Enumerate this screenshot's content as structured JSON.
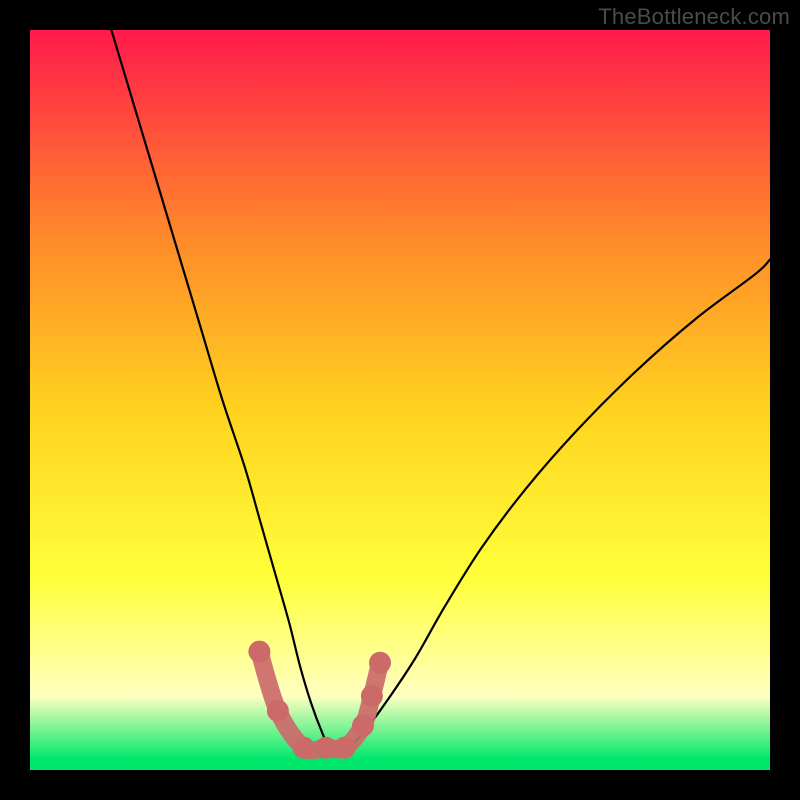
{
  "watermark": "TheBottleneck.com",
  "colors": {
    "frame_bg": "#000000",
    "gradient_top": "#ff1a4b",
    "gradient_mid_upper": "#ff8a2a",
    "gradient_mid": "#ffd41f",
    "gradient_mid_lower": "#ffff3a",
    "gradient_pale": "#ffffc0",
    "gradient_bottom": "#00e86b",
    "curve": "#000000",
    "marker": "#cc6a6a"
  },
  "chart_data": {
    "type": "line",
    "title": "",
    "xlabel": "",
    "ylabel": "",
    "xlim": [
      0,
      100
    ],
    "ylim": [
      0,
      100
    ],
    "grid": false,
    "series": [
      {
        "name": "bottleneck-curve",
        "x": [
          11,
          14,
          17,
          20,
          23,
          26,
          29,
          31,
          33,
          35,
          36.5,
          38,
          39.5,
          40.5,
          41.5,
          43,
          45,
          48,
          52,
          56,
          61,
          67,
          74,
          82,
          90,
          98,
          100
        ],
        "y": [
          100,
          90,
          80,
          70,
          60,
          50,
          41,
          34,
          27,
          20,
          14,
          9,
          5,
          3,
          3,
          3,
          5,
          9,
          15,
          22,
          30,
          38,
          46,
          54,
          61,
          67,
          69
        ]
      }
    ],
    "markers": {
      "name": "highlight-cluster",
      "x": [
        31.0,
        33.5,
        37.0,
        40.0,
        42.5,
        45.0,
        46.2,
        47.3
      ],
      "y": [
        16.0,
        8.0,
        3.0,
        3.0,
        3.0,
        6.0,
        10.0,
        14.5
      ]
    }
  }
}
